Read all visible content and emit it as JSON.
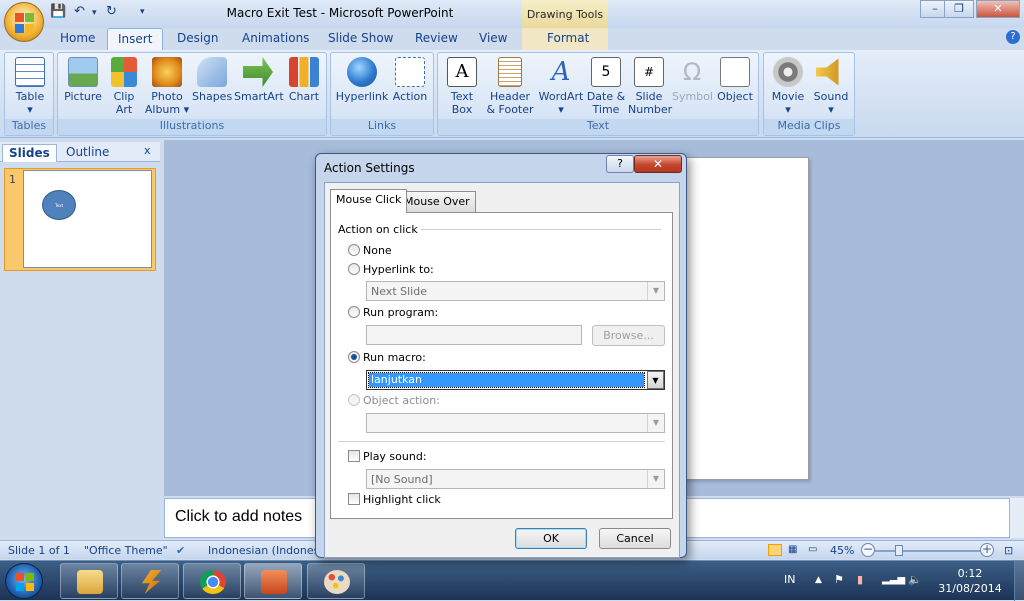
{
  "window": {
    "title": "Macro Exit Test - Microsoft PowerPoint",
    "context_tab_group": "Drawing Tools",
    "controls": [
      "–",
      "❐",
      "✕"
    ]
  },
  "ribbon_tabs": [
    "Home",
    "Insert",
    "Design",
    "Animations",
    "Slide Show",
    "Review",
    "View",
    "Format"
  ],
  "active_tab": "Insert",
  "ribbon": {
    "groups": [
      {
        "label": "Tables",
        "buttons": [
          {
            "label": "Table",
            "sub": "▾"
          }
        ]
      },
      {
        "label": "Illustrations",
        "buttons": [
          {
            "label": "Picture"
          },
          {
            "label": "Clip Art"
          },
          {
            "label": "Photo Album ▾"
          },
          {
            "label": "Shapes"
          },
          {
            "label": "SmartArt"
          },
          {
            "label": "Chart"
          }
        ]
      },
      {
        "label": "Links",
        "buttons": [
          {
            "label": "Hyperlink"
          },
          {
            "label": "Action"
          }
        ]
      },
      {
        "label": "Text",
        "buttons": [
          {
            "label": "Text Box"
          },
          {
            "label": "Header & Footer"
          },
          {
            "label": "WordArt",
            "sub": "▾"
          },
          {
            "label": "Date & Time"
          },
          {
            "label": "Slide Number"
          },
          {
            "label": "Symbol"
          },
          {
            "label": "Object"
          }
        ]
      },
      {
        "label": "Media Clips",
        "buttons": [
          {
            "label": "Movie",
            "sub": "▾"
          },
          {
            "label": "Sound",
            "sub": "▾"
          }
        ]
      }
    ]
  },
  "slide_panel": {
    "tabs": [
      "Slides",
      "Outline"
    ],
    "close": "x",
    "slide_number": "1",
    "thumb_text": "Text"
  },
  "notes": {
    "placeholder": "Click to add notes"
  },
  "status_bar": {
    "slide": "Slide 1 of 1",
    "theme": "\"Office Theme\"",
    "language": "Indonesian (Indones",
    "zoom": "45%"
  },
  "dialog": {
    "title": "Action Settings",
    "help": "?",
    "close": "✕",
    "tabs": [
      "Mouse Click",
      "Mouse Over"
    ],
    "section_label": "Action on click",
    "options": {
      "none": "None",
      "hyperlink": "Hyperlink to:",
      "hyperlink_value": "Next Slide",
      "run_program": "Run program:",
      "browse": "Browse...",
      "run_macro": "Run macro:",
      "macro_value": "lanjutkan",
      "object_action": "Object action:",
      "play_sound": "Play sound:",
      "sound_value": "[No Sound]",
      "highlight_click": "Highlight click"
    },
    "selected_option": "run_macro",
    "ok": "OK",
    "cancel": "Cancel"
  },
  "taskbar": {
    "tray_lang": "IN",
    "time": "0:12",
    "date": "31/08/2014"
  },
  "colors": {
    "office_blue": "#15428b",
    "ribbon_bg": "#dbe6f5",
    "selection_blue": "#3399ff",
    "taskbar": "#1b3356"
  }
}
